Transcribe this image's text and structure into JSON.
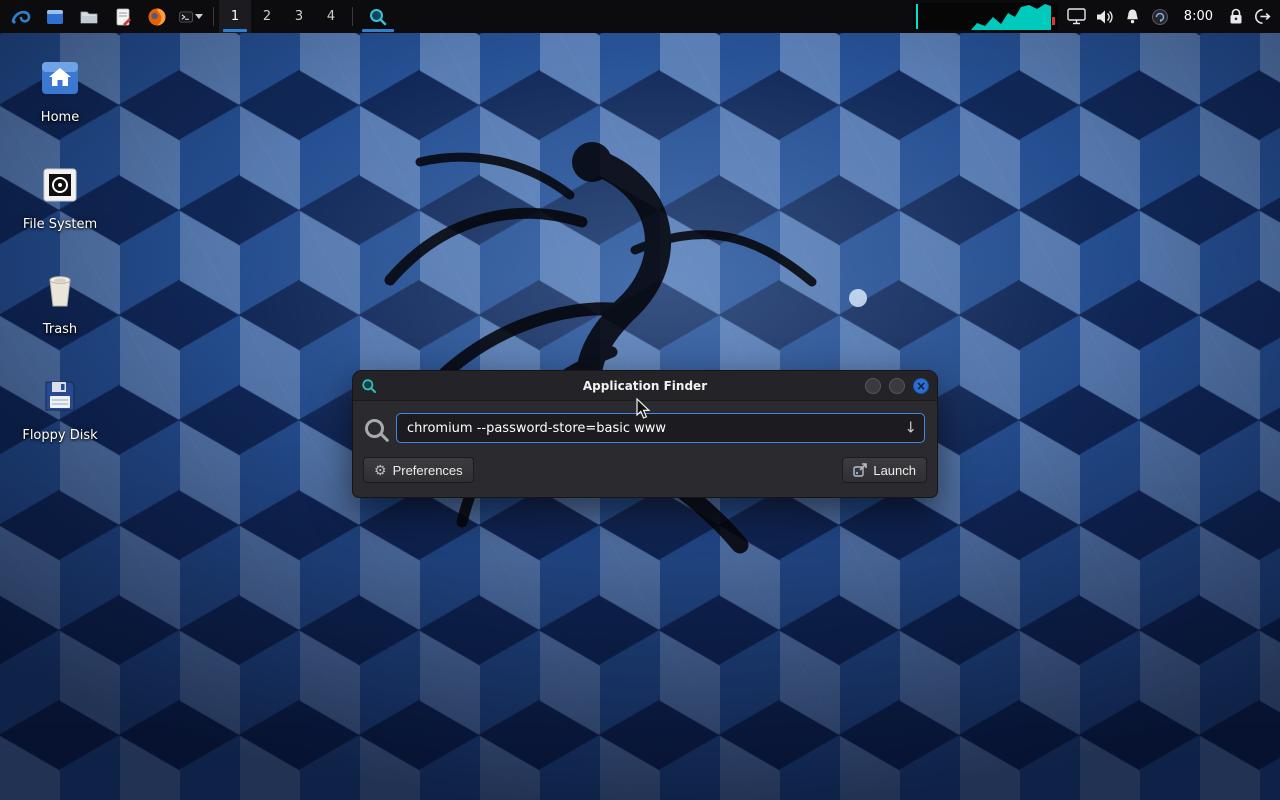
{
  "panel": {
    "workspaces": [
      "1",
      "2",
      "3",
      "4"
    ],
    "clock": "8:00"
  },
  "desktop": {
    "icons": [
      {
        "label": "Home"
      },
      {
        "label": "File System"
      },
      {
        "label": "Trash"
      },
      {
        "label": "Floppy Disk"
      }
    ]
  },
  "finder": {
    "title": "Application Finder",
    "input_value": "chromium --password-store=basic www",
    "preferences_label": "Preferences",
    "launch_label": "Launch"
  },
  "glyphs": {
    "gear": "⚙",
    "arrow_down": "↓",
    "close": "×"
  },
  "colors": {
    "accent": "#2f81c9",
    "close_button": "#2b6fd4",
    "cpu_graph": "#00e0cf",
    "input_focus_border": "#3f8ae0"
  }
}
